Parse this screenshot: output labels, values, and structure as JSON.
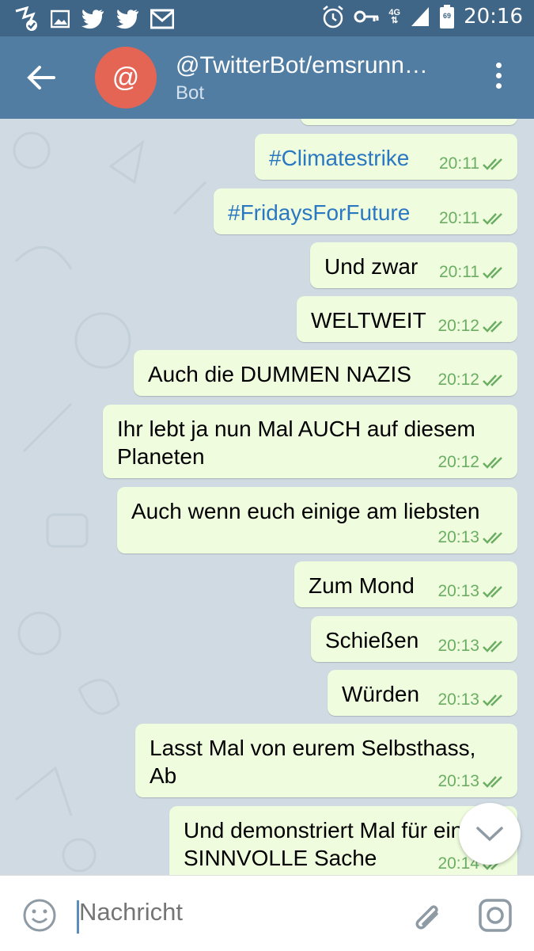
{
  "status_bar": {
    "time": "20:16",
    "network": "4G",
    "battery": "69",
    "icons": [
      "messenger-check-icon",
      "image-icon",
      "twitter-icon",
      "twitter-icon",
      "gmail-icon",
      "alarm-icon",
      "vpn-key-icon",
      "signal-icon",
      "battery-icon"
    ]
  },
  "header": {
    "title": "@TwitterBot/emsrunn…",
    "subtitle": "Bot",
    "avatar_text": "@",
    "avatar_color": "#e56555"
  },
  "messages": [
    {
      "text": "#Climatestrike",
      "time": "20:11",
      "hashtag": true
    },
    {
      "text": "#FridaysForFuture",
      "time": "20:11",
      "hashtag": true
    },
    {
      "text": "Und zwar",
      "time": "20:11"
    },
    {
      "text": "WELTWEIT",
      "time": "20:12"
    },
    {
      "text": "Auch die DUMMEN NAZIS",
      "time": "20:12"
    },
    {
      "text": "Ihr lebt ja nun Mal AUCH auf diesem Planeten",
      "time": "20:12"
    },
    {
      "text": "Auch wenn euch einige am liebsten",
      "time": "20:13"
    },
    {
      "text": "Zum Mond",
      "time": "20:13"
    },
    {
      "text": "Schießen",
      "time": "20:13"
    },
    {
      "text": "Würden",
      "time": "20:13"
    },
    {
      "text": "Lasst Mal von eurem Selbsthass, Ab",
      "time": "20:13"
    },
    {
      "text": "Und demonstriert Mal für eine SINNVOLLE Sache",
      "time": "20:14"
    }
  ],
  "input": {
    "placeholder": "Nachricht"
  },
  "colors": {
    "status_bar": "#3f6587",
    "header": "#527da3",
    "bubble_out": "#effdde",
    "time_text": "#6bae63",
    "hashtag": "#2b78c2",
    "chat_bg": "#cfdae2"
  }
}
